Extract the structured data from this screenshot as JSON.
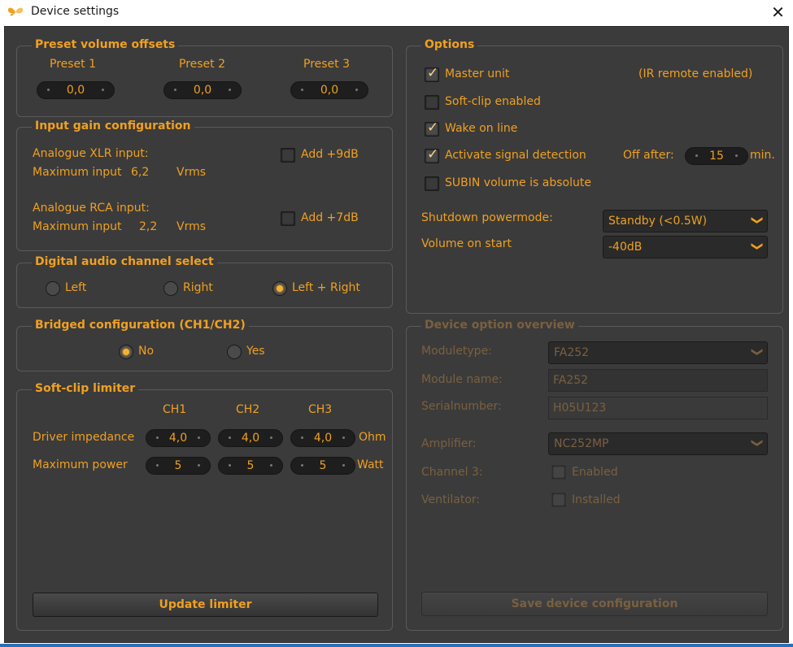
{
  "window": {
    "title": "Device settings",
    "close_glyph": "✕",
    "app_icon": "butterfly-icon"
  },
  "preset": {
    "title": "Preset volume offsets",
    "labels": [
      "Preset 1",
      "Preset 2",
      "Preset 3"
    ],
    "values": [
      "0,0",
      "0,0",
      "0,0"
    ]
  },
  "gain": {
    "title": "Input gain configuration",
    "xlr_label": "Analogue XLR input:",
    "xlr_max_label": "Maximum input",
    "xlr_max_value": "6,2",
    "xlr_unit": "Vrms",
    "xlr_add": "Add +9dB",
    "rca_label": "Analogue RCA input:",
    "rca_max_label": "Maximum input",
    "rca_max_value": "2,2",
    "rca_unit": "Vrms",
    "rca_add": "Add +7dB"
  },
  "digital": {
    "title": "Digital audio channel select",
    "left": "Left",
    "right": "Right",
    "both": "Left + Right"
  },
  "bridged": {
    "title": "Bridged configuration (CH1/CH2)",
    "no": "No",
    "yes": "Yes"
  },
  "softclip": {
    "title": "Soft-clip limiter",
    "channels": [
      "CH1",
      "CH2",
      "CH3"
    ],
    "impedance_label": "Driver impedance",
    "impedance_values": [
      "4,0",
      "4,0",
      "4,0"
    ],
    "impedance_unit": "Ohm",
    "power_label": "Maximum power",
    "power_values": [
      "5",
      "5",
      "5"
    ],
    "power_unit": "Watt",
    "update_button": "Update limiter"
  },
  "options": {
    "title": "Options",
    "master": "Master unit",
    "ir_note": "(IR remote enabled)",
    "softclip_enabled": "Soft-clip enabled",
    "wake": "Wake on line",
    "signal": "Activate signal detection",
    "off_after": "Off after:",
    "off_value": "15",
    "off_unit": "min.",
    "subin": "SUBIN volume is absolute",
    "shutdown_label": "Shutdown powermode:",
    "shutdown_value": "Standby (<0.5W)",
    "volume_label": "Volume on start",
    "volume_value": "-40dB"
  },
  "overview": {
    "title": "Device option overview",
    "moduletype_label": "Moduletype:",
    "moduletype_value": "FA252",
    "modulename_label": "Module name:",
    "modulename_value": "FA252",
    "serial_label": "Serialnumber:",
    "serial_value": "H05U123",
    "amplifier_label": "Amplifier:",
    "amplifier_value": "NC252MP",
    "ch3_label": "Channel 3:",
    "ch3_check": "Enabled",
    "vent_label": "Ventilator:",
    "vent_check": "Installed",
    "save_button": "Save device configuration"
  },
  "colors": {
    "accent": "#f0a020",
    "background": "#3b3b3b",
    "disabled": "#7a6040"
  }
}
